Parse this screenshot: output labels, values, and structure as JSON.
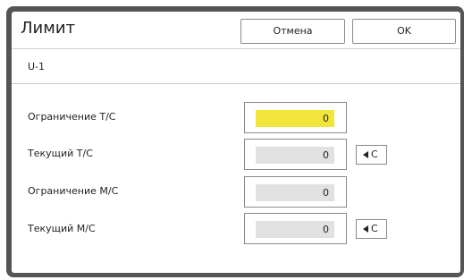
{
  "header": {
    "title": "Лимит",
    "cancel_label": "Отмена",
    "ok_label": "OK"
  },
  "subtitle": "U-1",
  "rows": [
    {
      "label": "Ограничение Т/С",
      "value": "0",
      "active": true,
      "clear": ""
    },
    {
      "label": "Текущий Т/С",
      "value": "0",
      "active": false,
      "clear": "C"
    },
    {
      "label": "Ограничение М/С",
      "value": "0",
      "active": false,
      "clear": ""
    },
    {
      "label": "Текущий М/С",
      "value": "0",
      "active": false,
      "clear": "C"
    }
  ],
  "colors": {
    "active_field": "#f1e43b",
    "inactive_field": "#e1e1e1",
    "frame": "#555555"
  },
  "icons": {
    "clear": "left-triangle-icon"
  }
}
